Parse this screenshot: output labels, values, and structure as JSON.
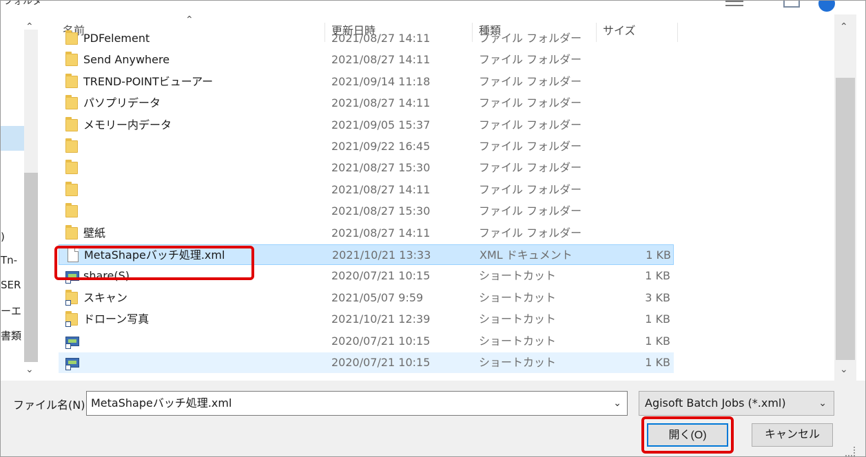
{
  "window": {
    "title_fragment": "フォルダー"
  },
  "left_pane": {
    "labels": [
      ")",
      "Tn-",
      "SER",
      "ーエ",
      "書類"
    ]
  },
  "columns": {
    "name": "名前",
    "date": "更新日時",
    "type": "種類",
    "size": "サイズ"
  },
  "files": [
    {
      "name": "PDFelement",
      "date": "2021/08/27 14:11",
      "type": "ファイル フォルダー",
      "size": "",
      "icon": "folder-icon"
    },
    {
      "name": "Send Anywhere",
      "date": "2021/08/27 14:11",
      "type": "ファイル フォルダー",
      "size": "",
      "icon": "folder-icon"
    },
    {
      "name": "TREND-POINTビューアー",
      "date": "2021/09/14 11:18",
      "type": "ファイル フォルダー",
      "size": "",
      "icon": "folder-icon"
    },
    {
      "name": "パソプリデータ",
      "date": "2021/08/27 14:11",
      "type": "ファイル フォルダー",
      "size": "",
      "icon": "folder-icon"
    },
    {
      "name": "メモリー内データ",
      "date": "2021/09/05 15:37",
      "type": "ファイル フォルダー",
      "size": "",
      "icon": "folder-icon"
    },
    {
      "name": "",
      "date": "2021/09/22 16:45",
      "type": "ファイル フォルダー",
      "size": "",
      "icon": "folder-icon"
    },
    {
      "name": "",
      "date": "2021/08/27 15:30",
      "type": "ファイル フォルダー",
      "size": "",
      "icon": "folder-icon"
    },
    {
      "name": "",
      "date": "2021/08/27 14:11",
      "type": "ファイル フォルダー",
      "size": "",
      "icon": "folder-icon"
    },
    {
      "name": "",
      "date": "2021/08/27 15:30",
      "type": "ファイル フォルダー",
      "size": "",
      "icon": "folder-icon"
    },
    {
      "name": "壁紙",
      "date": "2021/08/27 14:11",
      "type": "ファイル フォルダー",
      "size": "",
      "icon": "folder-icon"
    },
    {
      "name": "MetaShapeバッチ処理.xml",
      "date": "2021/10/21 13:33",
      "type": "XML ドキュメント",
      "size": "1 KB",
      "icon": "document-icon",
      "state": "selected"
    },
    {
      "name": "share(S)",
      "date": "2020/07/21 10:15",
      "type": "ショートカット",
      "size": "1 KB",
      "icon": "network-shortcut-icon"
    },
    {
      "name": "スキャン",
      "date": "2021/05/07 9:59",
      "type": "ショートカット",
      "size": "3 KB",
      "icon": "folder-shortcut-icon"
    },
    {
      "name": "ドローン写真",
      "date": "2021/10/21 12:39",
      "type": "ショートカット",
      "size": "1 KB",
      "icon": "folder-shortcut-icon"
    },
    {
      "name": "",
      "date": "2020/07/21 10:15",
      "type": "ショートカット",
      "size": "1 KB",
      "icon": "network-shortcut-icon"
    },
    {
      "name": "",
      "date": "2020/07/21 10:15",
      "type": "ショートカット",
      "size": "1 KB",
      "icon": "network-shortcut-icon",
      "state": "hovered"
    }
  ],
  "bottom": {
    "filename_label": "ファイル名(N):",
    "filename_value": "MetaShapeバッチ処理.xml",
    "filter_value": "Agisoft Batch Jobs (*.xml)",
    "open_label": "開く(O)",
    "cancel_label": "キャンセル"
  },
  "colors": {
    "selection": "#cce8ff",
    "highlight": "#e00000",
    "accent": "#0078d7"
  }
}
